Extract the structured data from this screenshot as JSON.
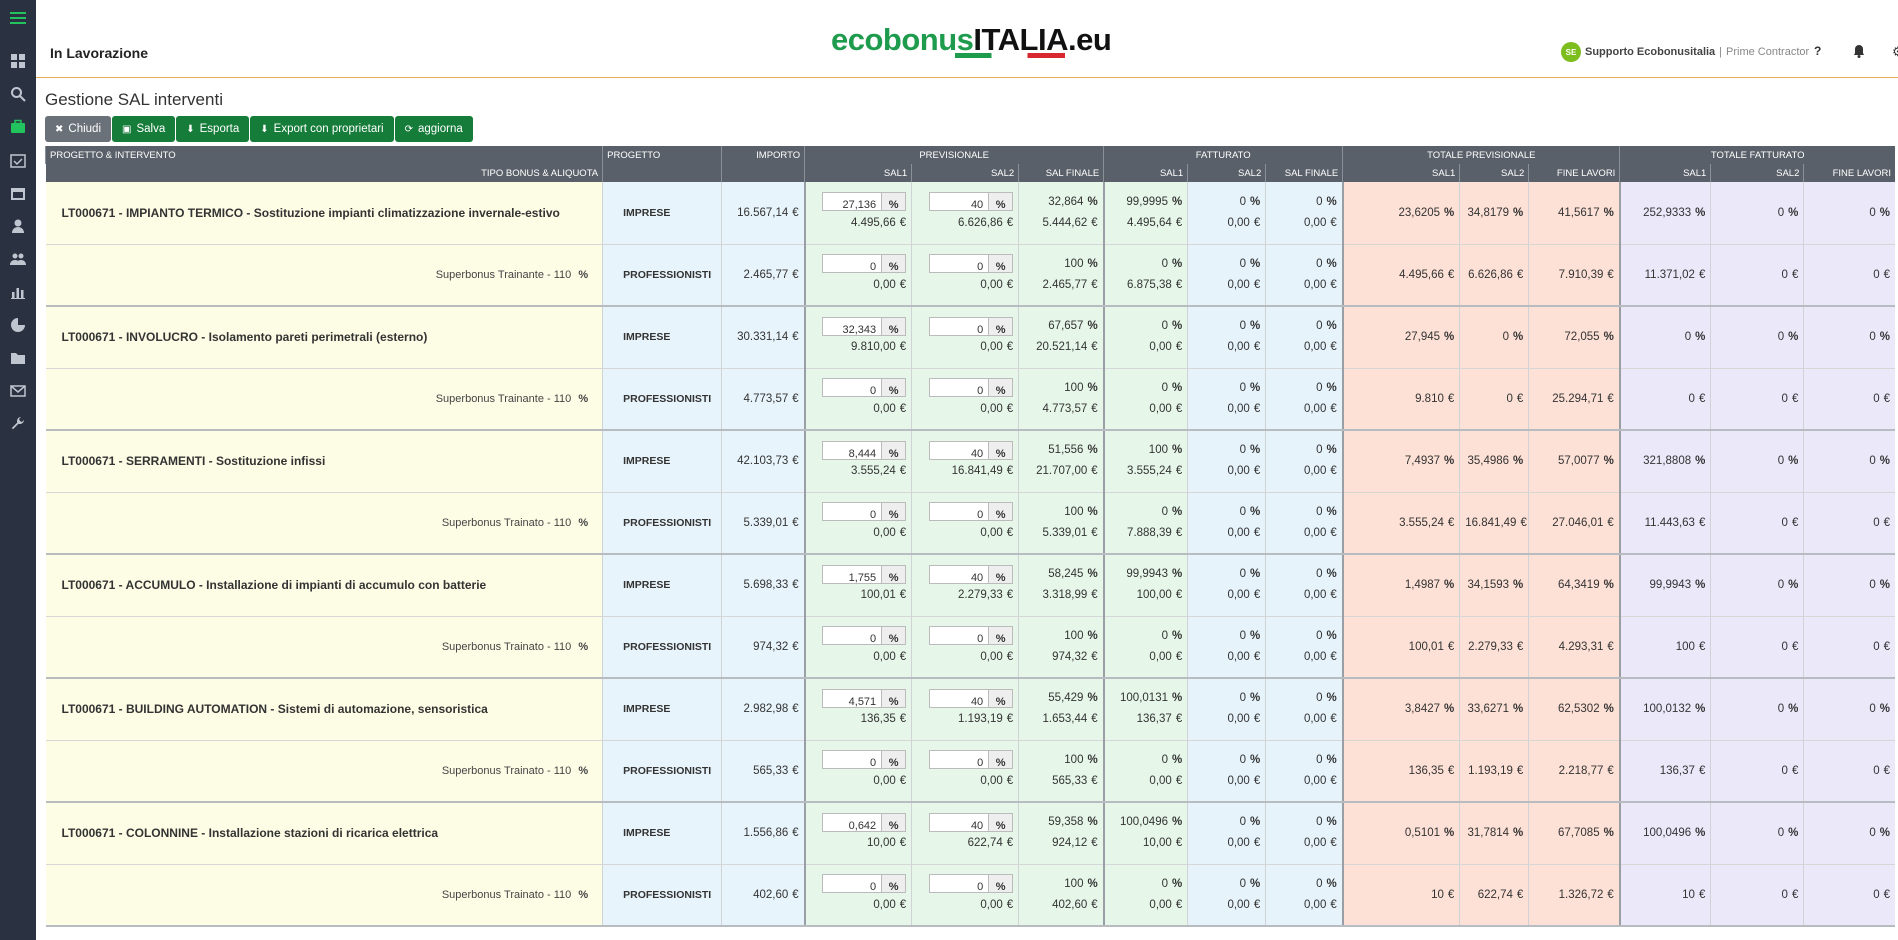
{
  "app": {
    "breadcrumb": "In Lavorazione",
    "logo": {
      "green": "ecobonus",
      "black": "ITALIA",
      "suffix": ".eu"
    },
    "user": {
      "initials": "SE",
      "name": "Supporto Ecobonusitalia",
      "separator": "|",
      "role": "Prime Contractor"
    },
    "help": "?"
  },
  "page": {
    "title": "Gestione SAL interventi"
  },
  "toolbar": {
    "close": "Chiudi",
    "save": "Salva",
    "export": "Esporta",
    "export_owners": "Export con proprietari",
    "refresh": "aggiorna"
  },
  "sidebar": {
    "icons": [
      "menu-icon",
      "dashboard-icon",
      "search-icon",
      "briefcase-icon",
      "calendar-check-icon",
      "calendar-icon",
      "user-icon",
      "users-icon",
      "bar-chart-icon",
      "pie-chart-icon",
      "folder-icon",
      "envelope-icon",
      "wrench-icon"
    ]
  },
  "headers": {
    "g1": "PROGETTO & INTERVENTO",
    "g1b": "TIPO BONUS & ALIQUOTA",
    "progetto": "PROGETTO",
    "importo": "IMPORTO",
    "previsionale": "PREVISIONALE",
    "fatturato": "FATTURATO",
    "totale_previsionale": "TOTALE PREVISIONALE",
    "totale_fatturato": "TOTALE FATTURATO",
    "sal1": "SAL1",
    "sal2": "SAL2",
    "sal_finale": "SAL FINALE",
    "fine_lavori": "FINE LAVORI"
  },
  "colors": {
    "header": "#5a6069",
    "green_button": "#157c3a",
    "accent": "#22c35e"
  },
  "interventions": [
    {
      "title": "LT000671 - IMPIANTO TERMICO - Sostituzione impianti climatizzazione invernale-estivo",
      "bonus": "Superbonus Trainante - 110",
      "rows": [
        {
          "proj": "IMPRESE",
          "importo": "16.567,14",
          "p1": "27,136",
          "p1e": "4.495,66",
          "p2": "40",
          "p2e": "6.626,86",
          "pf": "32,864",
          "pfe": "5.444,62",
          "f1": "99,9995",
          "f1e": "4.495,64",
          "f2": "0",
          "f2e": "0,00",
          "ff": "0",
          "ffe": "0,00",
          "tp1": "23,6205",
          "tp2": "34,8179",
          "tpf": "41,5617",
          "tf1": "252,9333",
          "tf2": "0",
          "tff": "0"
        },
        {
          "proj": "PROFESSIONISTI",
          "importo": "2.465,77",
          "p1": "0",
          "p1e": "0,00",
          "p2": "0",
          "p2e": "0,00",
          "pf": "100",
          "pfe": "2.465,77",
          "f1": "0",
          "f1e": "6.875,38",
          "f2": "0",
          "f2e": "0,00",
          "ff": "0",
          "ffe": "0,00",
          "tp1": "4.495,66",
          "tp2": "6.626,86",
          "tpf": "7.910,39",
          "tf1": "11.371,02",
          "tf2": "0",
          "tff": "0"
        }
      ]
    },
    {
      "title": "LT000671 - INVOLUCRO - Isolamento pareti perimetrali (esterno)",
      "bonus": "Superbonus Trainante - 110",
      "rows": [
        {
          "proj": "IMPRESE",
          "importo": "30.331,14",
          "p1": "32,343",
          "p1e": "9.810,00",
          "p2": "0",
          "p2e": "0,00",
          "pf": "67,657",
          "pfe": "20.521,14",
          "f1": "0",
          "f1e": "0,00",
          "f2": "0",
          "f2e": "0,00",
          "ff": "0",
          "ffe": "0,00",
          "tp1": "27,945",
          "tp2": "0",
          "tpf": "72,055",
          "tf1": "0",
          "tf2": "0",
          "tff": "0"
        },
        {
          "proj": "PROFESSIONISTI",
          "importo": "4.773,57",
          "p1": "0",
          "p1e": "0,00",
          "p2": "0",
          "p2e": "0,00",
          "pf": "100",
          "pfe": "4.773,57",
          "f1": "0",
          "f1e": "0,00",
          "f2": "0",
          "f2e": "0,00",
          "ff": "0",
          "ffe": "0,00",
          "tp1": "9.810",
          "tp2": "0",
          "tpf": "25.294,71",
          "tf1": "0",
          "tf2": "0",
          "tff": "0"
        }
      ]
    },
    {
      "title": "LT000671 - SERRAMENTI - Sostituzione infissi",
      "bonus": "Superbonus Trainato - 110",
      "rows": [
        {
          "proj": "IMPRESE",
          "importo": "42.103,73",
          "p1": "8,444",
          "p1e": "3.555,24",
          "p2": "40",
          "p2e": "16.841,49",
          "pf": "51,556",
          "pfe": "21.707,00",
          "f1": "100",
          "f1e": "3.555,24",
          "f2": "0",
          "f2e": "0,00",
          "ff": "0",
          "ffe": "0,00",
          "tp1": "7,4937",
          "tp2": "35,4986",
          "tpf": "57,0077",
          "tf1": "321,8808",
          "tf2": "0",
          "tff": "0"
        },
        {
          "proj": "PROFESSIONISTI",
          "importo": "5.339,01",
          "p1": "0",
          "p1e": "0,00",
          "p2": "0",
          "p2e": "0,00",
          "pf": "100",
          "pfe": "5.339,01",
          "f1": "0",
          "f1e": "7.888,39",
          "f2": "0",
          "f2e": "0,00",
          "ff": "0",
          "ffe": "0,00",
          "tp1": "3.555,24",
          "tp2": "16.841,49",
          "tpf": "27.046,01",
          "tf1": "11.443,63",
          "tf2": "0",
          "tff": "0"
        }
      ]
    },
    {
      "title": "LT000671 - ACCUMULO - Installazione di impianti di accumulo con batterie",
      "bonus": "Superbonus Trainato - 110",
      "rows": [
        {
          "proj": "IMPRESE",
          "importo": "5.698,33",
          "p1": "1,755",
          "p1e": "100,01",
          "p2": "40",
          "p2e": "2.279,33",
          "pf": "58,245",
          "pfe": "3.318,99",
          "f1": "99,9943",
          "f1e": "100,00",
          "f2": "0",
          "f2e": "0,00",
          "ff": "0",
          "ffe": "0,00",
          "tp1": "1,4987",
          "tp2": "34,1593",
          "tpf": "64,3419",
          "tf1": "99,9943",
          "tf2": "0",
          "tff": "0"
        },
        {
          "proj": "PROFESSIONISTI",
          "importo": "974,32",
          "p1": "0",
          "p1e": "0,00",
          "p2": "0",
          "p2e": "0,00",
          "pf": "100",
          "pfe": "974,32",
          "f1": "0",
          "f1e": "0,00",
          "f2": "0",
          "f2e": "0,00",
          "ff": "0",
          "ffe": "0,00",
          "tp1": "100,01",
          "tp2": "2.279,33",
          "tpf": "4.293,31",
          "tf1": "100",
          "tf2": "0",
          "tff": "0"
        }
      ]
    },
    {
      "title": "LT000671 - BUILDING AUTOMATION - Sistemi di automazione, sensoristica",
      "bonus": "Superbonus Trainato - 110",
      "rows": [
        {
          "proj": "IMPRESE",
          "importo": "2.982,98",
          "p1": "4,571",
          "p1e": "136,35",
          "p2": "40",
          "p2e": "1.193,19",
          "pf": "55,429",
          "pfe": "1.653,44",
          "f1": "100,0131",
          "f1e": "136,37",
          "f2": "0",
          "f2e": "0,00",
          "ff": "0",
          "ffe": "0,00",
          "tp1": "3,8427",
          "tp2": "33,6271",
          "tpf": "62,5302",
          "tf1": "100,0132",
          "tf2": "0",
          "tff": "0"
        },
        {
          "proj": "PROFESSIONISTI",
          "importo": "565,33",
          "p1": "0",
          "p1e": "0,00",
          "p2": "0",
          "p2e": "0,00",
          "pf": "100",
          "pfe": "565,33",
          "f1": "0",
          "f1e": "0,00",
          "f2": "0",
          "f2e": "0,00",
          "ff": "0",
          "ffe": "0,00",
          "tp1": "136,35",
          "tp2": "1.193,19",
          "tpf": "2.218,77",
          "tf1": "136,37",
          "tf2": "0",
          "tff": "0"
        }
      ]
    },
    {
      "title": "LT000671 - COLONNINE - Installazione stazioni di ricarica elettrica",
      "bonus": "Superbonus Trainato - 110",
      "rows": [
        {
          "proj": "IMPRESE",
          "importo": "1.556,86",
          "p1": "0,642",
          "p1e": "10,00",
          "p2": "40",
          "p2e": "622,74",
          "pf": "59,358",
          "pfe": "924,12",
          "f1": "100,0496",
          "f1e": "10,00",
          "f2": "0",
          "f2e": "0,00",
          "ff": "0",
          "ffe": "0,00",
          "tp1": "0,5101",
          "tp2": "31,7814",
          "tpf": "67,7085",
          "tf1": "100,0496",
          "tf2": "0",
          "tff": "0"
        },
        {
          "proj": "PROFESSIONISTI",
          "importo": "402,60",
          "p1": "0",
          "p1e": "0,00",
          "p2": "0",
          "p2e": "0,00",
          "pf": "100",
          "pfe": "402,60",
          "f1": "0",
          "f1e": "0,00",
          "f2": "0",
          "f2e": "0,00",
          "ff": "0",
          "ffe": "0,00",
          "tp1": "10",
          "tp2": "622,74",
          "tpf": "1.326,72",
          "tf1": "10",
          "tf2": "0",
          "tff": "0"
        }
      ]
    }
  ],
  "symbols": {
    "pct": "%",
    "eur": "€"
  }
}
